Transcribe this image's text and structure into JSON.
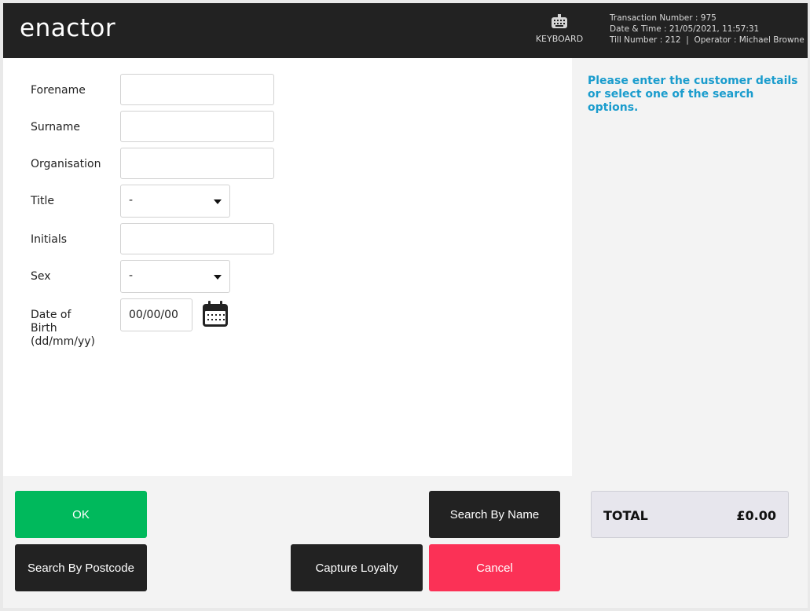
{
  "header": {
    "logo_text": "enactor",
    "keyboard_label": "KEYBOARD",
    "transaction_number": "Transaction Number : 975",
    "date_time": "Date & Time : 21/05/2021, 11:57:31",
    "till_operator": "Till Number : 212  |  Operator : Michael Browne"
  },
  "form": {
    "forename_label": "Forename",
    "forename_value": "",
    "surname_label": "Surname",
    "surname_value": "",
    "organisation_label": "Organisation",
    "organisation_value": "",
    "title_label": "Title",
    "title_value": "-",
    "initials_label": "Initials",
    "initials_value": "",
    "sex_label": "Sex",
    "sex_value": "-",
    "dob_label_line1": "Date of",
    "dob_label_line2": "Birth",
    "dob_label_line3": "(dd/mm/yy)",
    "dob_value": "00/00/00"
  },
  "side": {
    "message": "Please enter the customer details or select one of the search options."
  },
  "buttons": {
    "ok": "OK",
    "search_by_name": "Search By Name",
    "search_by_postcode": "Search By Postcode",
    "capture_loyalty": "Capture Loyalty",
    "cancel": "Cancel"
  },
  "total": {
    "label": "TOTAL",
    "amount": "£0.00"
  },
  "colors": {
    "header_bg": "#222222",
    "accent_blue": "#1a9ccd",
    "ok_green": "#00b95c",
    "cancel_red": "#fb3156",
    "dark_button": "#222222"
  },
  "icons": {
    "keyboard": "keyboard-icon",
    "calendar": "calendar-icon",
    "dropdown": "chevron-down-icon"
  }
}
